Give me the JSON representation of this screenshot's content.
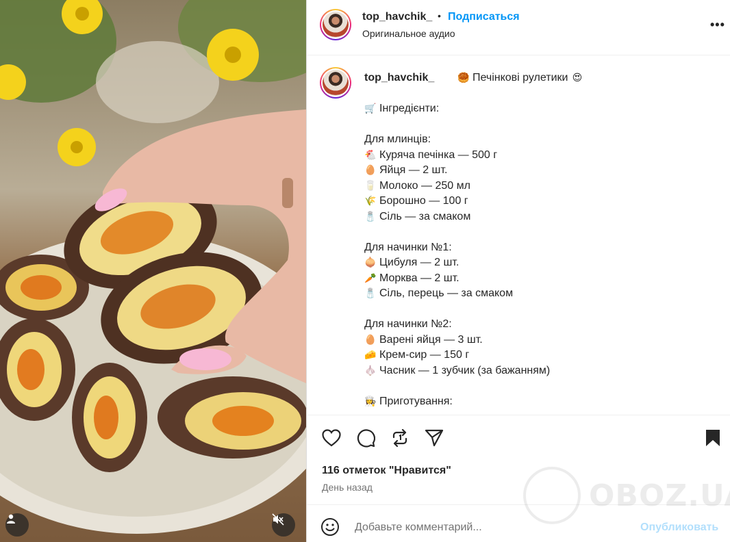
{
  "header": {
    "username": "top_havchik_",
    "separator": "•",
    "follow_label": "Подписаться",
    "audio_label": "Оригинальное аудио",
    "more_icon": "more-horizontal-icon"
  },
  "caption": {
    "username": "top_havchik_",
    "title": "Печінкові рулетики",
    "title_emoji_before": "🥮",
    "title_emoji_after": "😍",
    "lines": [
      {
        "emoji": "🛒",
        "text": "Інгредієнти:"
      },
      {
        "emoji": "",
        "text": ""
      },
      {
        "emoji": "",
        "text": "Для млинців:"
      },
      {
        "emoji": "🐔",
        "text": "Куряча печінка — 500 г"
      },
      {
        "emoji": "🥚",
        "text": "Яйця — 2 шт."
      },
      {
        "emoji": "🥛",
        "text": "Молоко — 250 мл"
      },
      {
        "emoji": "🌾",
        "text": "Борошно — 100 г"
      },
      {
        "emoji": "🧂",
        "text": "Сіль — за смаком"
      },
      {
        "emoji": "",
        "text": ""
      },
      {
        "emoji": "",
        "text": "Для начинки №1:"
      },
      {
        "emoji": "🧅",
        "text": "Цибуля — 2 шт."
      },
      {
        "emoji": "🥕",
        "text": "Морква — 2 шт."
      },
      {
        "emoji": "🧂",
        "text": "Сіль, перець — за смаком"
      },
      {
        "emoji": "",
        "text": ""
      },
      {
        "emoji": "",
        "text": "Для начинки №2:"
      },
      {
        "emoji": "🥚",
        "text": "Варені яйця — 3 шт."
      },
      {
        "emoji": "🧀",
        "text": "Крем-сир — 150 г"
      },
      {
        "emoji": "🧄",
        "text": "Часник — 1 зубчик (за бажанням)"
      },
      {
        "emoji": "",
        "text": ""
      },
      {
        "emoji": "👩‍🍳",
        "text": "Приготування:"
      }
    ]
  },
  "actions": {
    "likes_text": "116 отметок \"Нравится\"",
    "date_text": "День назад"
  },
  "comment": {
    "placeholder": "Добавьте комментарий...",
    "post_label": "Опубликовать"
  },
  "watermark": {
    "text": "OBOZ.UA"
  },
  "colors": {
    "accent": "#0095f6",
    "post_disabled": "#b2dffc",
    "muted": "#737373"
  }
}
